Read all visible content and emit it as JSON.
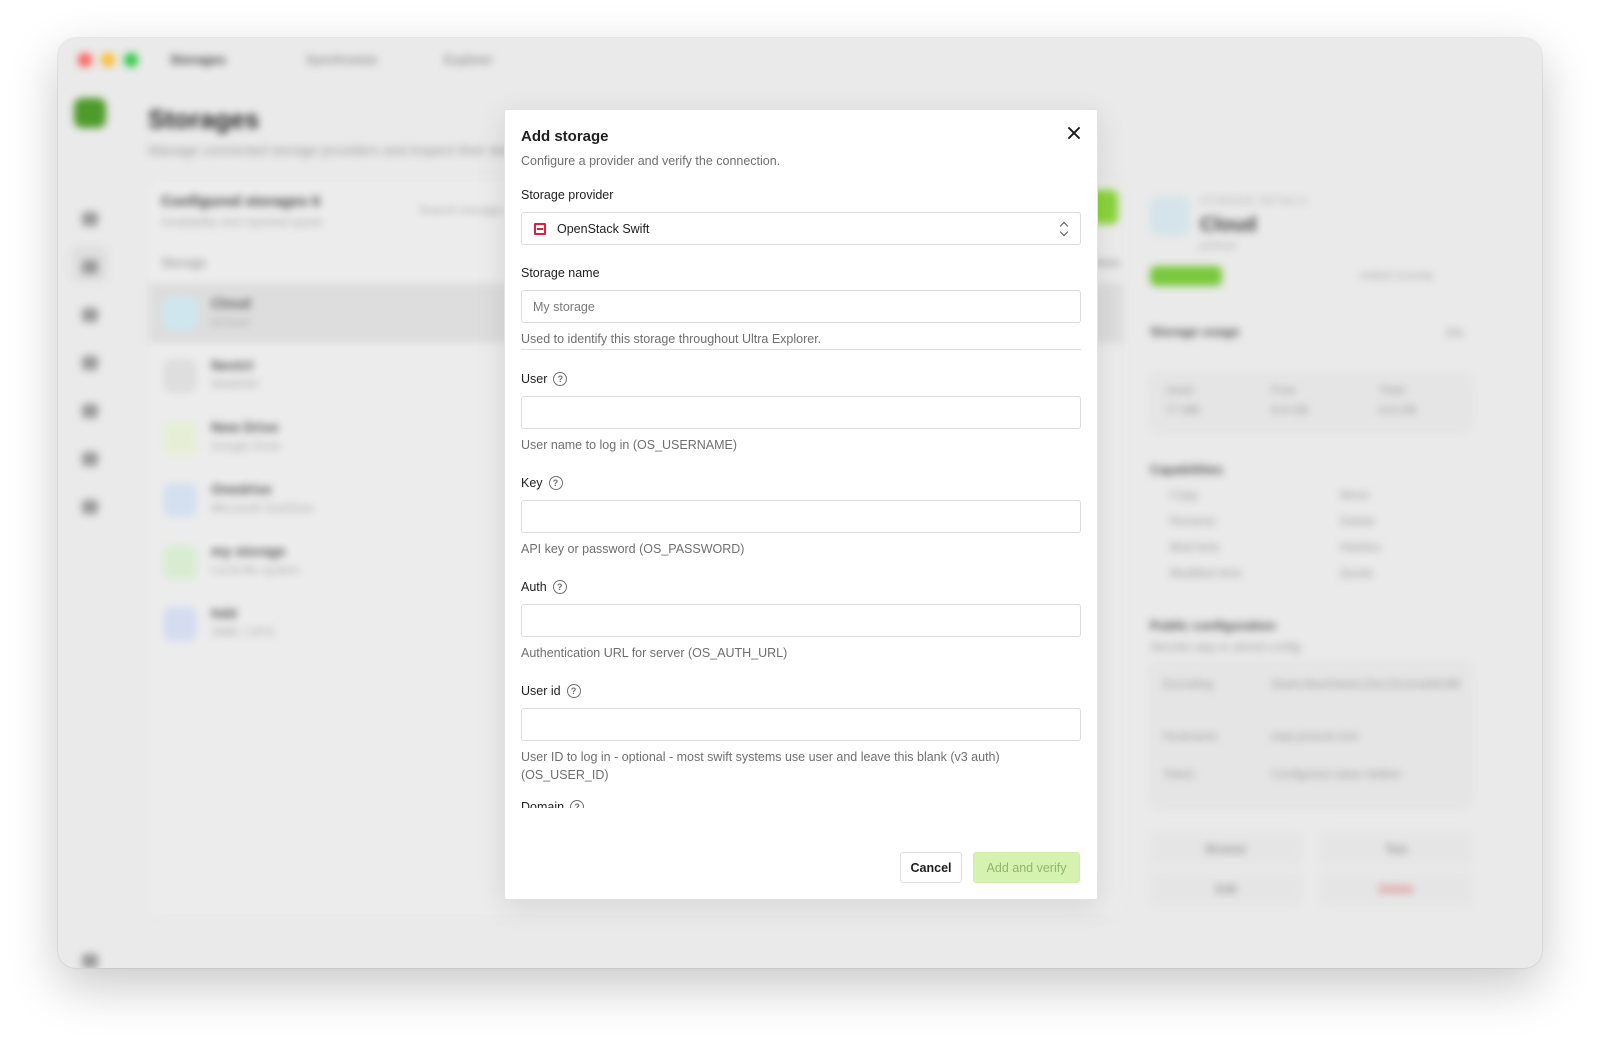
{
  "window": {
    "tabs": [
      "Storages",
      "Synchronize",
      "Explorer"
    ],
    "main_title": "Storages",
    "main_subtitle": "Manage connected storage providers and inspect their details",
    "list_title": "Configured storages",
    "list_count": "6",
    "list_subtitle": "Availability and reported quota",
    "search_placeholder": "Search storages",
    "column_storage": "Storage",
    "column_actions": "Actions",
    "rows": [
      {
        "name": "Cloud",
        "desc": "pCloud",
        "icon_color": "#cfe6ee"
      },
      {
        "name": "Nextcl",
        "desc": "WebDAV",
        "icon_color": "#dedede"
      },
      {
        "name": "New Drive",
        "desc": "Google Drive",
        "icon_color": "#e6efd6"
      },
      {
        "name": "Onedrive",
        "desc": "Microsoft OneDrive",
        "icon_color": "#d4e0f0"
      },
      {
        "name": "my storage",
        "desc": "Local file system",
        "icon_color": "#d8ecd0"
      },
      {
        "name": "hdd",
        "desc": "SMB / CIFS",
        "icon_color": "#d4dcf0"
      }
    ],
    "detail": {
      "label": "STORAGE DETAILS",
      "name": "Cloud",
      "sub": "pCloud",
      "date": "Added recently",
      "usage_title": "Storage usage",
      "usage_pct": "0%",
      "stats": [
        [
          "Used",
          "77 MB"
        ],
        [
          "Free",
          "9.9 GB"
        ],
        [
          "Total",
          "9.9 GB"
        ]
      ],
      "capabilities_title": "Capabilities",
      "capabilities": [
        "Copy",
        "Move",
        "Rename",
        "Delete",
        "Mod time",
        "Hashes",
        "Modified time",
        "Quota"
      ],
      "config_title": "Public configuration",
      "config_sub": "Secrets stay in stored config",
      "config_rows": [
        [
          "Encoding",
          "Slash,BackSlash,Del,Ctl,InvalidUtf8"
        ],
        [
          "Hostname",
          "eapi.pcloud.com"
        ],
        [
          "Token",
          "Configured value hidden"
        ]
      ],
      "buttons": [
        "Browse",
        "Test",
        "Edit",
        "Delete"
      ]
    }
  },
  "modal": {
    "title": "Add storage",
    "subtitle": "Configure a provider and verify the connection.",
    "provider_label": "Storage provider",
    "provider_value": "OpenStack Swift",
    "provider_icon_color": "#d9253c",
    "name_label": "Storage name",
    "name_placeholder": "My storage",
    "name_help": "Used to identify this storage throughout Ultra Explorer.",
    "fields": [
      {
        "label": "User",
        "help": "User name to log in (OS_USERNAME)"
      },
      {
        "label": "Key",
        "help": "API key or password (OS_PASSWORD)"
      },
      {
        "label": "Auth",
        "help": "Authentication URL for server (OS_AUTH_URL)"
      },
      {
        "label": "User id",
        "help": "User ID to log in - optional - most swift systems use user and leave this blank (v3 auth) (OS_USER_ID)"
      },
      {
        "label": "Domain",
        "help": ""
      }
    ],
    "cancel_label": "Cancel",
    "submit_label": "Add and verify"
  },
  "colors": {
    "accent_green": "#8ad53a",
    "submit_disabled_bg": "#d6f2b0",
    "traffic_red": "#fe5f57",
    "traffic_yellow": "#febc2e",
    "traffic_green": "#28c840"
  }
}
